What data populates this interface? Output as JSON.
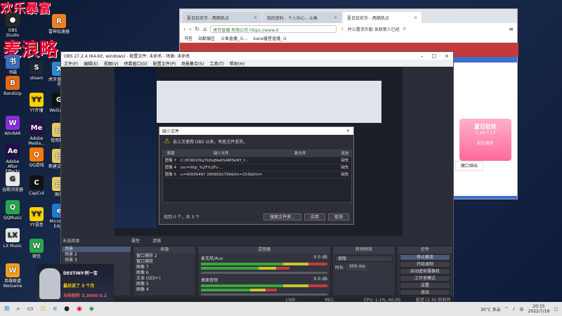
{
  "watermark": {
    "top": "欢乐暴富",
    "middle": "麦浪略"
  },
  "desktop_icons": [
    {
      "label": "OBS Studio",
      "glyph": "●",
      "color": "#2a2a2a"
    },
    {
      "label": "书磁",
      "glyph": "书",
      "color": "#3a6cc0"
    },
    {
      "label": "Bandizip",
      "glyph": "B",
      "color": "#e06a1a"
    },
    {
      "label": "WinRAR",
      "glyph": "W",
      "color": "#8a2be2"
    },
    {
      "label": "Adobe After Effects 2021",
      "glyph": "Ae",
      "color": "#1f0f4a"
    },
    {
      "label": "谷歌浏览器",
      "glyph": "G",
      "color": "#e8e8e8"
    },
    {
      "label": "QQMusic",
      "glyph": "Q",
      "color": "#22a84a"
    },
    {
      "label": "LX Music",
      "glyph": "LX",
      "color": "#e8e8e8"
    },
    {
      "label": "英雄联盟WeGame",
      "glyph": "W",
      "color": "#f0a020"
    },
    {
      "label": "steam",
      "glyph": "S",
      "color": "#1b2838"
    },
    {
      "label": "YY开播",
      "glyph": "YY",
      "color": "#ffd200"
    },
    {
      "label": "Adobe Media...",
      "glyph": "Me",
      "color": "#2a0f4a"
    },
    {
      "label": "QQ游戏",
      "glyph": "Q",
      "color": "#ff7a00"
    },
    {
      "label": "CapCut",
      "glyph": "C",
      "color": "#111"
    },
    {
      "label": "YY语音",
      "glyph": "YY",
      "color": "#ffd200"
    },
    {
      "label": "微信",
      "glyph": "W",
      "color": "#2aa84a"
    },
    {
      "label": "雷神加速器",
      "glyph": "R",
      "color": "#f08020"
    },
    {
      "label": "虎牙直播助手",
      "glyph": "X",
      "color": "#2a8ad0"
    },
    {
      "label": "WeGame",
      "glyph": "G",
      "color": "#111"
    },
    {
      "label": "常用软件",
      "glyph": "▤",
      "color": "#e8c860"
    },
    {
      "label": "新建文件夹",
      "glyph": "▤",
      "color": "#e8c860"
    },
    {
      "label": "图片",
      "glyph": "▤",
      "color": "#e8c860"
    },
    {
      "label": "Microsoft Edge",
      "glyph": "e",
      "color": "#1b7ad0"
    }
  ],
  "browser": {
    "tabs": [
      {
        "label": "夏日狂欢节 - 两栖热点",
        "active": false
      },
      {
        "label": "我的资料 - 个人中心 - 斗鱼",
        "active": false
      },
      {
        "label": "夏日狂欢节 - 两栖热点",
        "active": true
      }
    ],
    "url": "https://www.d",
    "url_prefix": "虎牙直播 有限公司",
    "search_text": "并公署求外勤 发政策人已经",
    "bookmarks": [
      "书签",
      "站勤展区",
      "斗鱼直播_斗...",
      "kane番星直播_斗"
    ],
    "sidebar": {
      "title": "夏日狂欢",
      "date": "7.16-7.17",
      "cta": "前往报名",
      "link": "魔口弹出"
    }
  },
  "obs": {
    "title": "OBS 27.2.4 (64-bit, windows) - 配置文件: 未命名 - 场景: 未命名",
    "menu": [
      "文件(F)",
      "编辑(E)",
      "视图(V)",
      "停靠窗口(D)",
      "配置文件(P)",
      "场景集合(S)",
      "工具(T)",
      "帮助(H)"
    ],
    "source_label": "未选择源",
    "filter_label": "滤镜",
    "properties_label": "属性",
    "docks": {
      "scenes": {
        "title": "场景",
        "items": [
          "场景",
          "场景 2",
          "场景 3"
        ]
      },
      "sources": {
        "title": "来源",
        "items": [
          "窗口捕获 2",
          "窗口捕获",
          "图像 7",
          "图像 6",
          "文本 (GDI+)",
          "图像 5",
          "图像 4"
        ]
      },
      "mixer": {
        "title": "混音器",
        "tracks": [
          {
            "name": "麦克风/Aux",
            "level": "0.0 dB"
          },
          {
            "name": "桌面音频",
            "level": "0.0 dB"
          }
        ]
      },
      "transitions": {
        "title": "转场特效",
        "type": "渐隐",
        "duration_label": "时长",
        "duration": "300 ms"
      },
      "controls": {
        "title": "控件",
        "buttons": [
          "停止推流",
          "开始录制",
          "启动虚拟摄像机",
          "工作室模式",
          "设置",
          "退出"
        ]
      }
    },
    "status": {
      "live": "LIVE: 00:00:00",
      "rec": "REC: 00:00:00",
      "cpu": "CPU: 1.1%, 60.00 fps",
      "bitrate": "延迟 (2 30 秒后开始)"
    }
  },
  "dialog": {
    "title": "缺少文件",
    "message": "自上次使用 OBS 以来，有些文件丢失。",
    "columns": [
      "来源",
      "缺少文件",
      "新文件",
      "状态"
    ],
    "rows": [
      {
        "source": "图像 7",
        "missing": "C:\\fCN01fXq7bDsJNaRSAM3eNY_f...",
        "new": "",
        "status": "缺失"
      },
      {
        "source": "图像 4",
        "missing": "src=http_%2F%2Fc-...",
        "new": "",
        "status": "缺失"
      },
      {
        "source": "图像 5",
        "missing": "u=4000049? 3958091799&fm=253&fmt=au...",
        "new": "",
        "status": "缺失"
      }
    ],
    "footer": "找到 0 个，共 3 个",
    "buttons": [
      "搜索文件夹...",
      "应用",
      "取消"
    ]
  },
  "webcam": {
    "line1": "DESTINY-阿一宝",
    "line2": "最后说了 3 个月",
    "line3": "与你相伴 3,3000 0.2"
  },
  "taskbar": {
    "weather": "30°C 多云",
    "time": "20:15",
    "date": "2022/7/16",
    "lang": "中"
  }
}
